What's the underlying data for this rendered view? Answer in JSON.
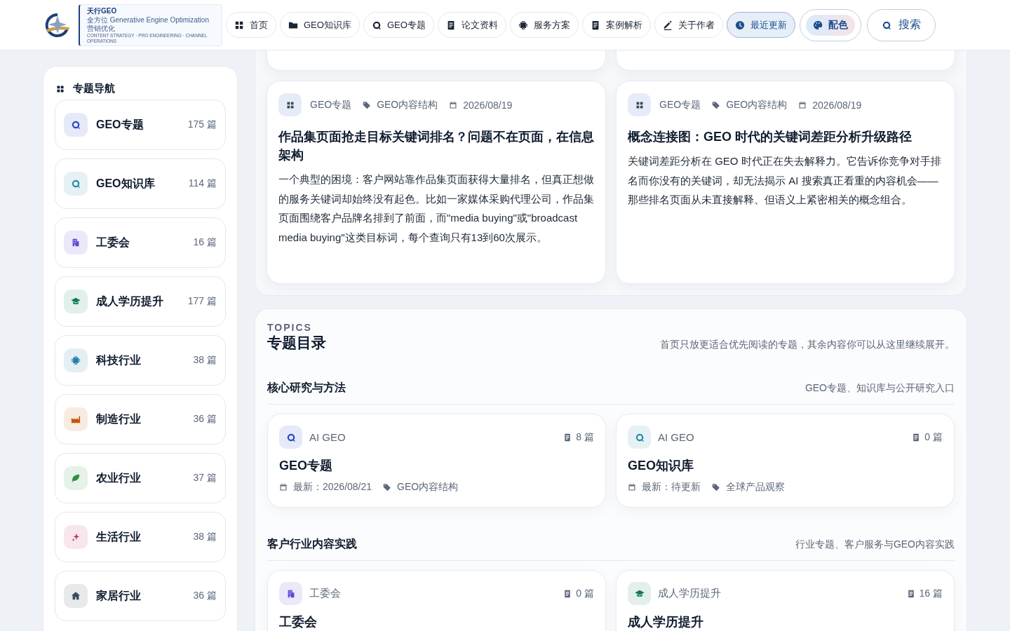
{
  "header": {
    "logo": {
      "name": "天行GEO",
      "tagline": "全方位 Generative Engine Optimization 营销优化",
      "subline": "CONTENT STRATEGY · PRO ENGINEERING · CHANNEL OPERATIONS"
    },
    "nav": [
      {
        "label": "首页",
        "selected": false
      },
      {
        "label": "GEO知识库",
        "selected": false
      },
      {
        "label": "GEO专题",
        "selected": false
      },
      {
        "label": "论文资料",
        "selected": false
      },
      {
        "label": "服务方案",
        "selected": false
      },
      {
        "label": "案例解析",
        "selected": false
      },
      {
        "label": "关于作者",
        "selected": false
      },
      {
        "label": "最近更新",
        "selected": true
      }
    ],
    "palette_button": {
      "label": "配色"
    },
    "search_button": {
      "label": "搜索"
    }
  },
  "sidebar": {
    "title": "专题导航",
    "items": [
      {
        "name": "GEO专题",
        "count": "175 篇",
        "color": "#2946c8"
      },
      {
        "name": "GEO知识库",
        "count": "114 篇",
        "color": "#2a8aa8"
      },
      {
        "name": "工委会",
        "count": "16 篇",
        "color": "#5b45d6"
      },
      {
        "name": "成人学历提升",
        "count": "177 篇",
        "color": "#11795a"
      },
      {
        "name": "科技行业",
        "count": "38 篇",
        "color": "#1e7fa6"
      },
      {
        "name": "制造行业",
        "count": "36 篇",
        "color": "#c2570c"
      },
      {
        "name": "农业行业",
        "count": "37 篇",
        "color": "#2f8f3e"
      },
      {
        "name": "生活行业",
        "count": "38 篇",
        "color": "#c2306a"
      },
      {
        "name": "家居行业",
        "count": "36 篇",
        "color": "#3c4a5c"
      }
    ]
  },
  "articles": [
    {
      "category": "GEO专题",
      "tag": "GEO内容结构",
      "date": "2026/08/19",
      "title": "作品集页面抢走目标关键词排名？问题不在页面，在信息架构",
      "excerpt": "一个典型的困境：客户网站靠作品集页面获得大量排名，但真正想做的服务关键词却始终没有起色。比如一家媒体采购代理公司，作品集页面围绕客户品牌名排到了前面，而\"media buying\"或\"broadcast media buying\"这类目标词，每个查询只有13到60次展示。"
    },
    {
      "category": "GEO专题",
      "tag": "GEO内容结构",
      "date": "2026/08/19",
      "title": "概念连接图：GEO 时代的关键词差距分析升级路径",
      "excerpt": "关键词差距分析在 GEO 时代正在失去解释力。它告诉你竞争对手排名而你没有的关键词，却无法揭示 AI 搜索真正看重的内容机会——那些排名页面从未直接解释、但语义上紧密相关的概念组合。"
    }
  ],
  "topics": {
    "eyebrow": "TOPICS",
    "title": "专题目录",
    "description": "首页只放更适合优先阅读的专题，其余内容你可以从这里继续展开。",
    "groups": [
      {
        "title": "核心研究与方法",
        "subtitle": "GEO专题、知识库与公开研究入口",
        "cards": [
          {
            "color": "#2946c8",
            "label": "AI GEO",
            "count": "8 篇",
            "title": "GEO专题",
            "latest": "最新：2026/08/21",
            "tag": "GEO内容结构"
          },
          {
            "color": "#2a8aa8",
            "label": "AI GEO",
            "count": "0 篇",
            "title": "GEO知识库",
            "latest": "最新：待更新",
            "tag": "全球产品观察"
          }
        ]
      },
      {
        "title": "客户行业内容实践",
        "subtitle": "行业专题、客户服务与GEO内容实践",
        "cards": [
          {
            "color": "#5b45d6",
            "label": "工委会",
            "count": "0 篇",
            "title": "工委会"
          },
          {
            "color": "#11795a",
            "label": "成人学历提升",
            "count": "16 篇",
            "title": "成人学历提升"
          }
        ]
      }
    ]
  }
}
